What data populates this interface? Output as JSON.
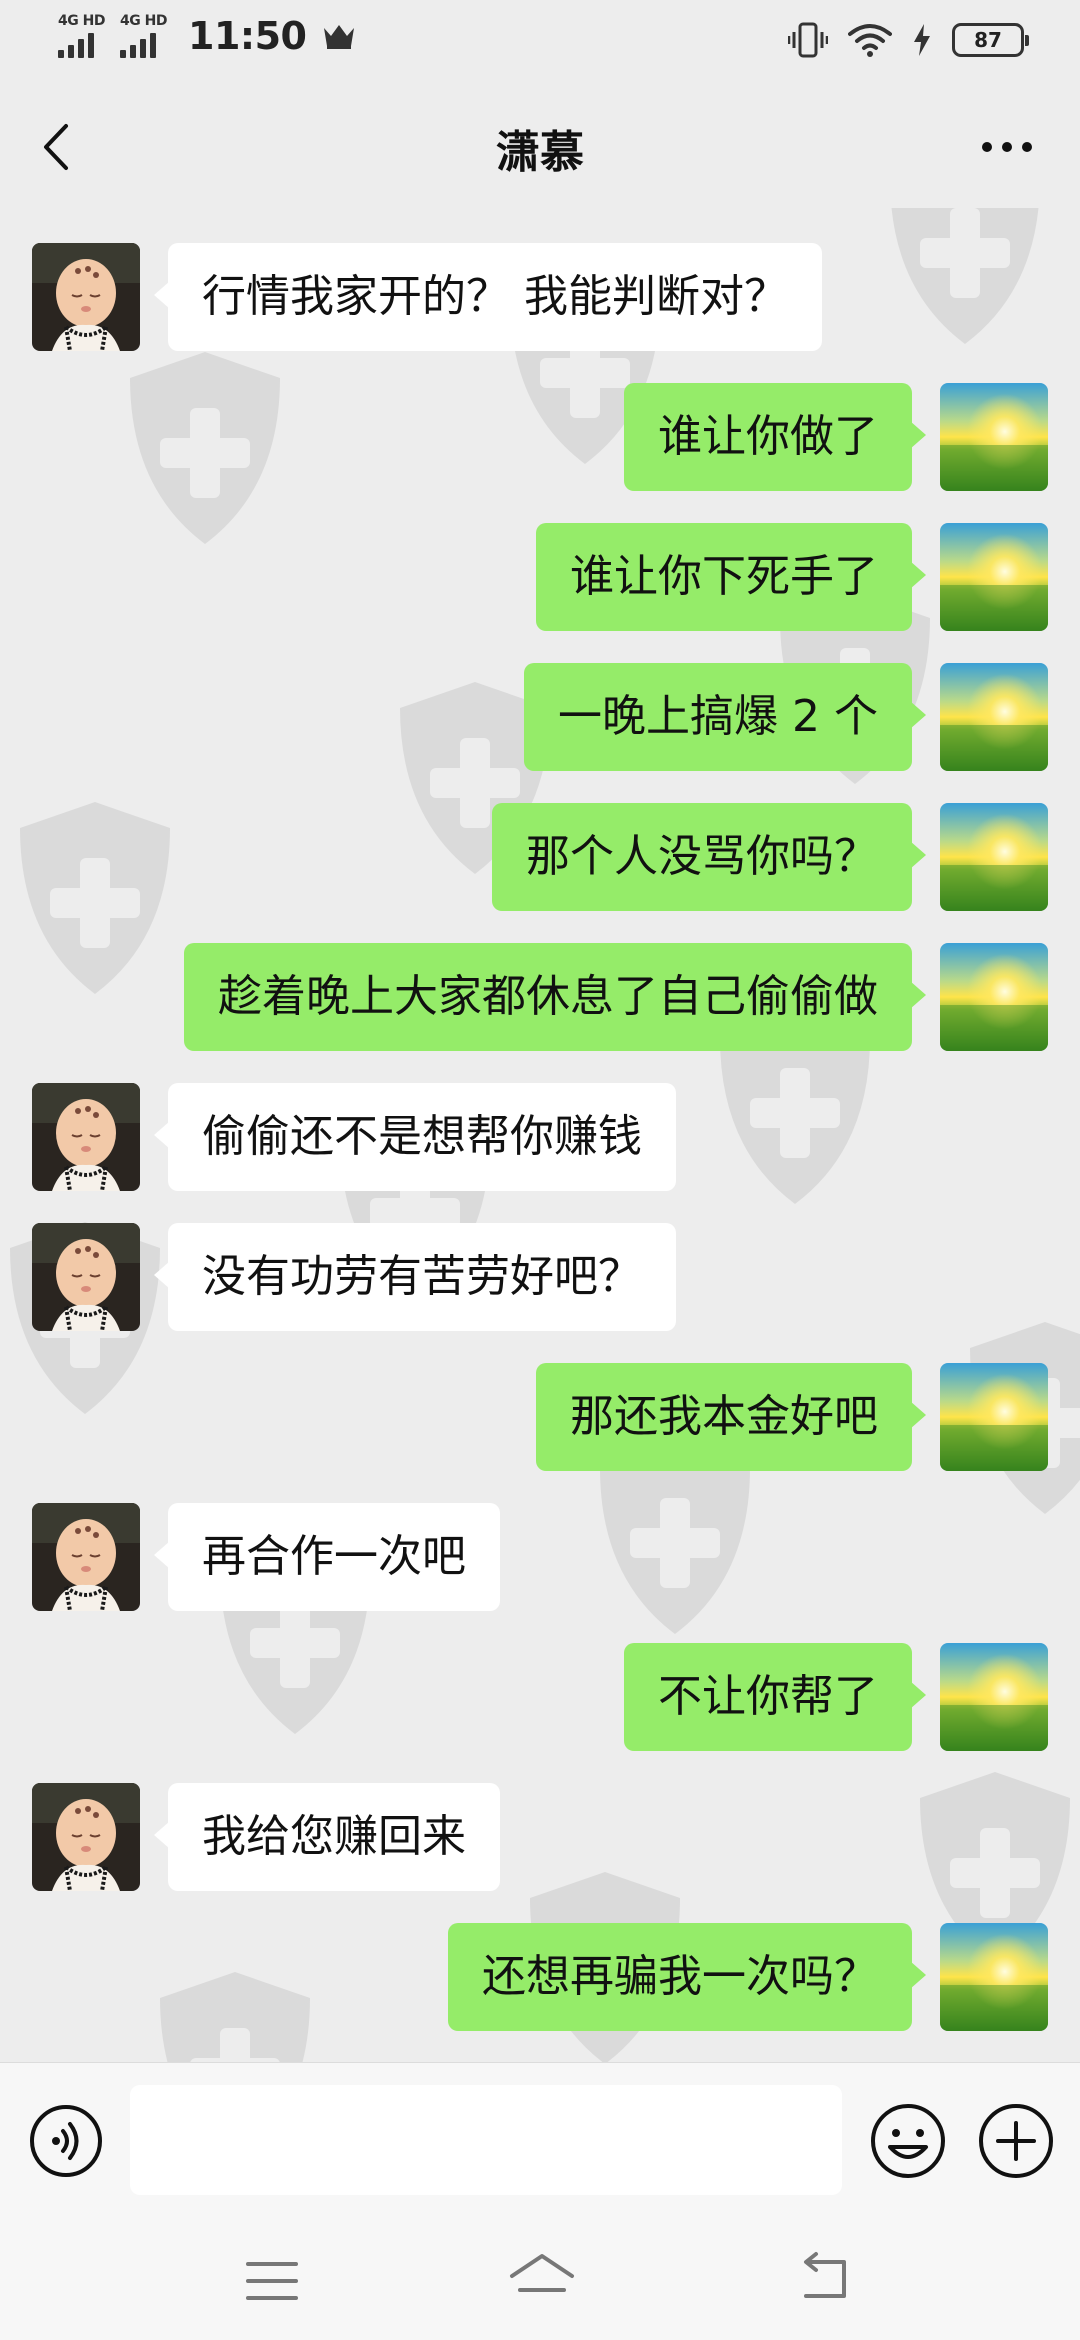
{
  "status_bar": {
    "network_1": "4G HD",
    "network_2": "4G HD",
    "time": "11:50",
    "battery": "87"
  },
  "header": {
    "title": "潇慕"
  },
  "messages": [
    {
      "sender": "contact",
      "text": "行情我家开的？ 我能判断对？"
    },
    {
      "sender": "me",
      "text": "谁让你做了"
    },
    {
      "sender": "me",
      "text": "谁让你下死手了"
    },
    {
      "sender": "me",
      "text": "一晚上搞爆 2 个"
    },
    {
      "sender": "me",
      "text": "那个人没骂你吗？"
    },
    {
      "sender": "me",
      "text": "趁着晚上大家都休息了自己偷偷做"
    },
    {
      "sender": "contact",
      "text": "偷偷还不是想帮你赚钱"
    },
    {
      "sender": "contact",
      "text": "没有功劳有苦劳好吧？"
    },
    {
      "sender": "me",
      "text": "那还我本金好吧"
    },
    {
      "sender": "contact",
      "text": "再合作一次吧"
    },
    {
      "sender": "me",
      "text": "不让你帮了"
    },
    {
      "sender": "contact",
      "text": "我给您赚回来"
    },
    {
      "sender": "me",
      "text": "还想再骗我一次吗？"
    }
  ],
  "input": {
    "value": "",
    "placeholder": ""
  },
  "colors": {
    "outgoing_bubble": "#95ec69",
    "incoming_bubble": "#ffffff",
    "background": "#ededed"
  },
  "icons": {
    "back": "chevron-left-icon",
    "more": "more-dots-icon",
    "voice": "voice-icon",
    "emoji": "emoji-icon",
    "add": "plus-circle-icon",
    "watermark": "shield-cross-icon"
  }
}
